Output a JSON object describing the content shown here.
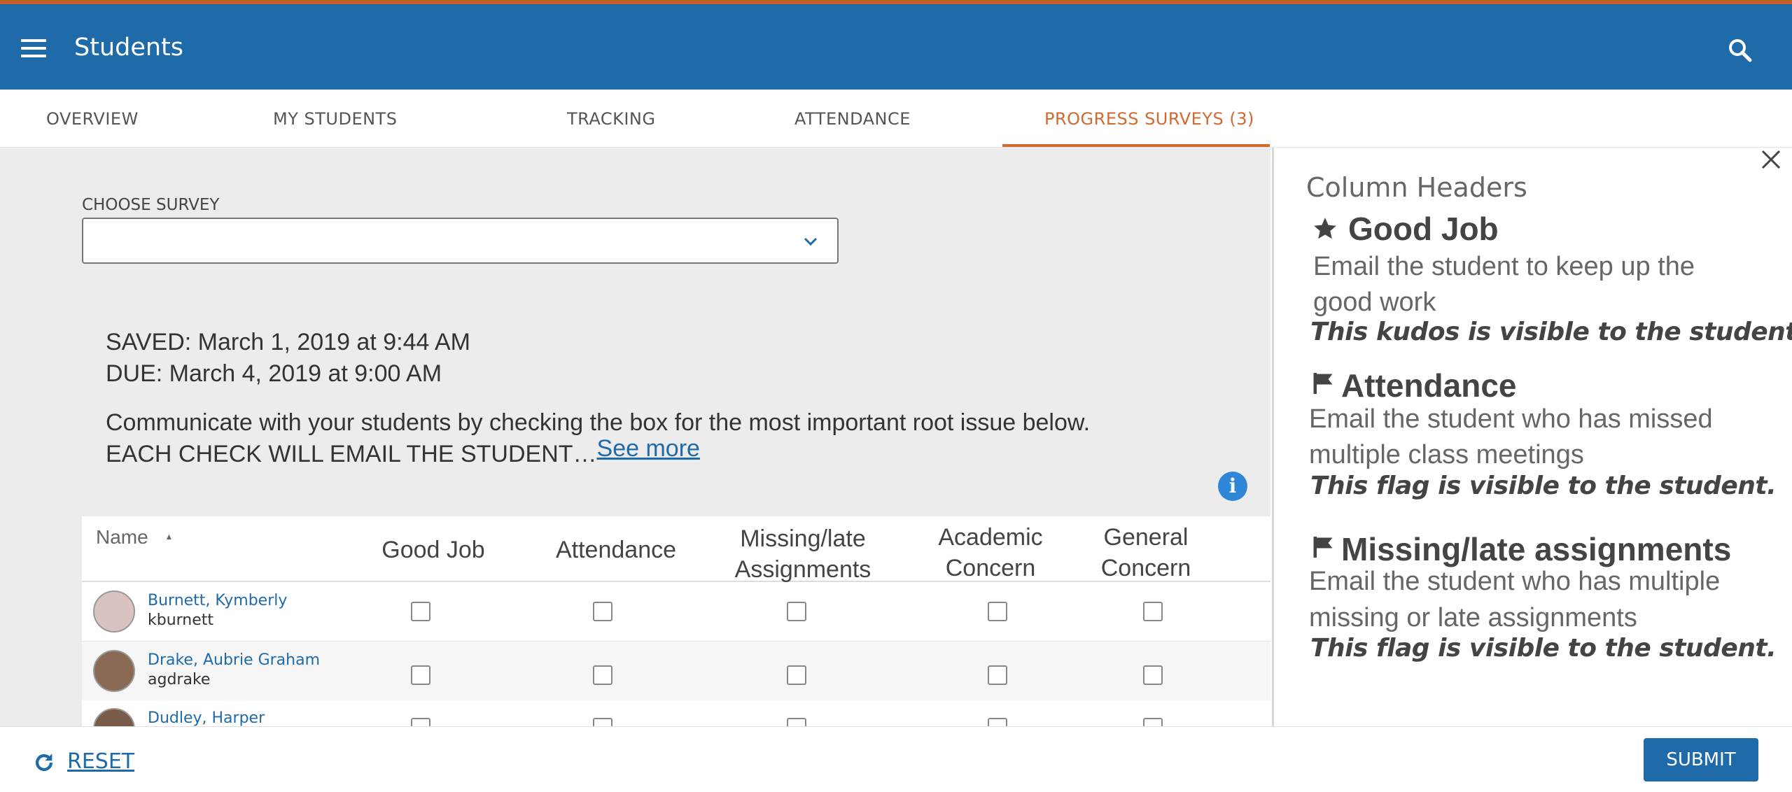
{
  "app": {
    "title": "Students"
  },
  "tabs": [
    {
      "label": "OVERVIEW"
    },
    {
      "label": "MY STUDENTS"
    },
    {
      "label": "TRACKING"
    },
    {
      "label": "ATTENDANCE"
    },
    {
      "label": "PROGRESS SURVEYS (3)",
      "active": true
    }
  ],
  "survey": {
    "choose_label": "CHOOSE SURVEY",
    "saved": "SAVED: March 1, 2019 at 9:44 AM",
    "due": "DUE: March 4, 2019 at 9:00 AM",
    "instructions_line1": "Communicate with your students by checking the box for the most important root issue below.",
    "instructions_line2": "EACH CHECK WILL EMAIL THE STUDENT…",
    "see_more": "See more",
    "info_icon": "info-icon"
  },
  "table": {
    "name_header": "Name",
    "sort_indicator": "▲",
    "columns": [
      {
        "line1": "Good Job",
        "line2": ""
      },
      {
        "line1": "Attendance",
        "line2": ""
      },
      {
        "line1": "Missing/late",
        "line2": "Assignments"
      },
      {
        "line1": "Academic",
        "line2": "Concern"
      },
      {
        "line1": "General",
        "line2": "Concern"
      }
    ],
    "rows": [
      {
        "name": "Burnett, Kymberly",
        "username": "kburnett",
        "checks": [
          false,
          false,
          false,
          false,
          false
        ]
      },
      {
        "name": "Drake, Aubrie Graham",
        "username": "agdrake",
        "checks": [
          false,
          false,
          false,
          false,
          false
        ]
      },
      {
        "name": "Dudley, Harper",
        "username": "",
        "checks": [
          false,
          false,
          false,
          false,
          false
        ]
      }
    ]
  },
  "panel": {
    "title": "Column Headers",
    "items": [
      {
        "icon": "star-icon",
        "heading": "Good Job",
        "desc_line1": "Email the student to keep up the",
        "desc_line2": "good work",
        "note": "This kudos is visible to the student."
      },
      {
        "icon": "flag-icon",
        "heading": "Attendance",
        "desc_line1": "Email the student who has missed",
        "desc_line2": "multiple class meetings",
        "note": "This flag is visible to the student."
      },
      {
        "icon": "flag-icon",
        "heading": "Missing/late assignments",
        "desc_line1": "Email the student who has multiple",
        "desc_line2": "missing or late assignments",
        "note": "This flag is visible to the student."
      }
    ]
  },
  "footer": {
    "reset_label": "RESET",
    "submit_label": "SUBMIT"
  },
  "colors": {
    "primary": "#1f6aa8",
    "accent": "#d06a2f",
    "info": "#2f86d6"
  }
}
